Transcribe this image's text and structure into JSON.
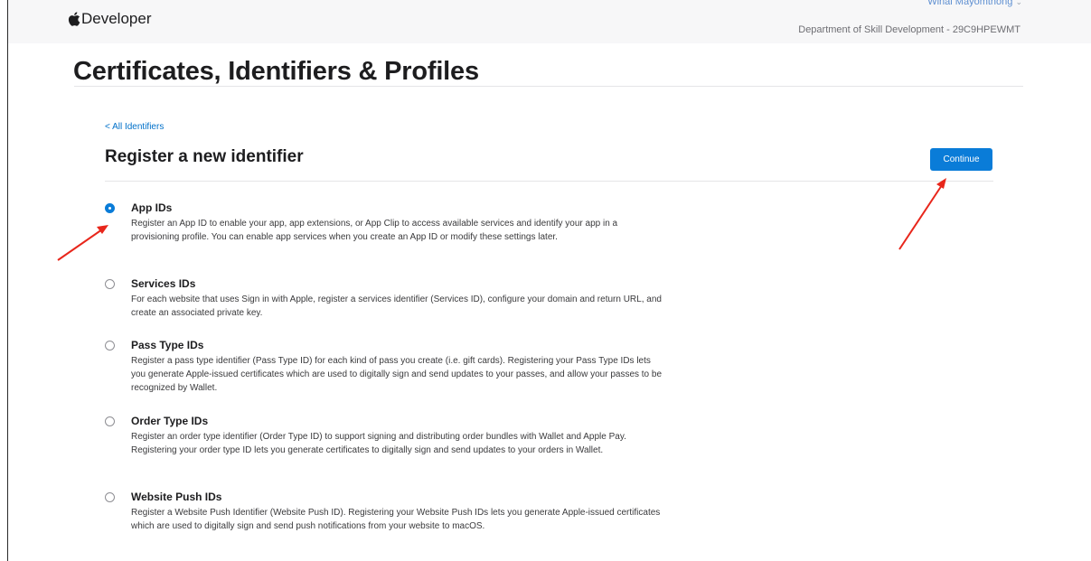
{
  "header": {
    "brand": "Developer",
    "user_name": "Winai Mayomthong",
    "team": "Department of Skill Development - 29C9HPEWMT"
  },
  "page_title": "Certificates, Identifiers & Profiles",
  "back_link": "< All Identifiers",
  "section_title": "Register a new identifier",
  "continue_label": "Continue",
  "options": [
    {
      "title": "App IDs",
      "selected": true,
      "desc": "Register an App ID to enable your app, app extensions, or App Clip to access available services and identify your app in a provisioning profile. You can enable app services when you create an App ID or modify these settings later."
    },
    {
      "title": "Services IDs",
      "selected": false,
      "desc": "For each website that uses Sign in with Apple, register a services identifier (Services ID), configure your domain and return URL, and create an associated private key."
    },
    {
      "title": "Pass Type IDs",
      "selected": false,
      "desc": "Register a pass type identifier (Pass Type ID) for each kind of pass you create (i.e. gift cards). Registering your Pass Type IDs lets you generate Apple-issued certificates which are used to digitally sign and send updates to your passes, and allow your passes to be recognized by Wallet."
    },
    {
      "title": "Order Type IDs",
      "selected": false,
      "desc": "Register an order type identifier (Order Type ID) to support signing and distributing order bundles with Wallet and Apple Pay. Registering your order type ID lets you generate certificates to digitally sign and send updates to your orders in Wallet."
    },
    {
      "title": "Website Push IDs",
      "selected": false,
      "desc": "Register a Website Push Identifier (Website Push ID). Registering your Website Push IDs lets you generate Apple-issued certificates which are used to digitally sign and send push notifications from your website to macOS."
    }
  ],
  "colors": {
    "accent": "#0a7cd8",
    "annotation_arrow": "#e8261b"
  }
}
